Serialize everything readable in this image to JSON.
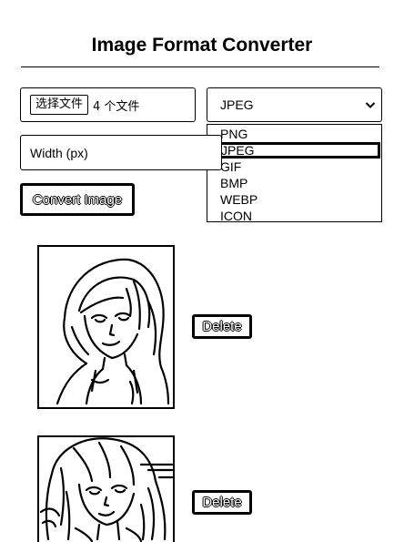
{
  "page": {
    "title": "Image Format Converter"
  },
  "file_input": {
    "button_label": "选择文件",
    "status_text": "4 个文件"
  },
  "format_select": {
    "selected": "JPEG",
    "options": [
      "PNG",
      "JPEG",
      "GIF",
      "BMP",
      "WEBP",
      "ICON"
    ],
    "highlighted_index": 1
  },
  "width_input": {
    "placeholder": "Width (px)",
    "value": ""
  },
  "convert_button": {
    "label": "Convert Image"
  },
  "images": [
    {
      "delete_label": "Delete",
      "icon": "hooded-girl-sketch-image"
    },
    {
      "delete_label": "Delete",
      "icon": "long-hair-girl-sketch-image"
    }
  ]
}
